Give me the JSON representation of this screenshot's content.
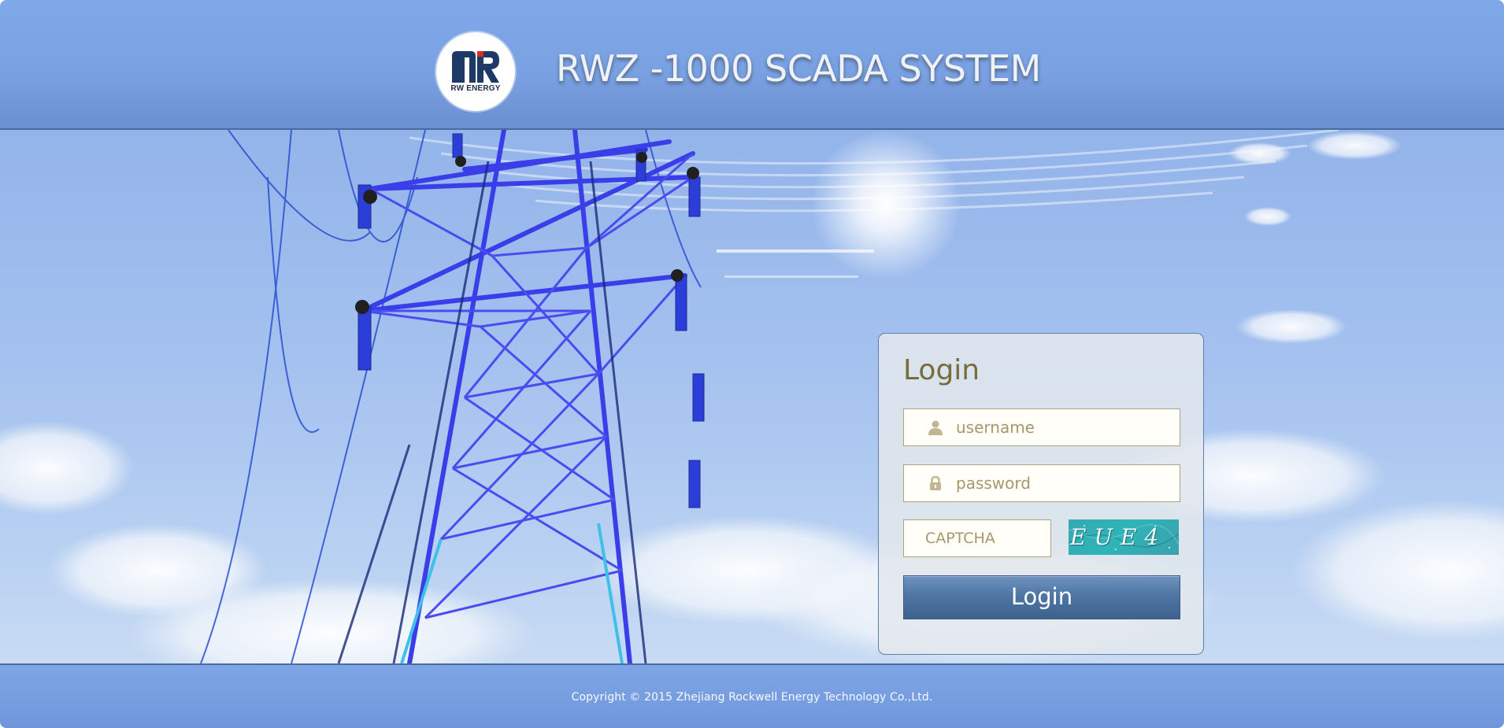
{
  "header": {
    "logo_text": "RW ENERGY",
    "title": "RWZ -1000 SCADA SYSTEM"
  },
  "login": {
    "heading": "Login",
    "username_placeholder": "username",
    "password_placeholder": "password",
    "captcha_placeholder": "CAPTCHA",
    "captcha_text": "EUE4",
    "button_label": "Login"
  },
  "footer": {
    "copyright": "Copyright © 2015 Zhejiang Rockwell Energy Technology Co.,Ltd."
  },
  "icons": {
    "username": "user-icon",
    "password": "lock-icon",
    "logo": "rw-energy-logo-icon"
  },
  "colors": {
    "header_blue": "#7aa2e2",
    "heading_olive": "#786b3c",
    "button_blue": "#4f76a4",
    "captcha_teal": "#2fb4b8"
  }
}
